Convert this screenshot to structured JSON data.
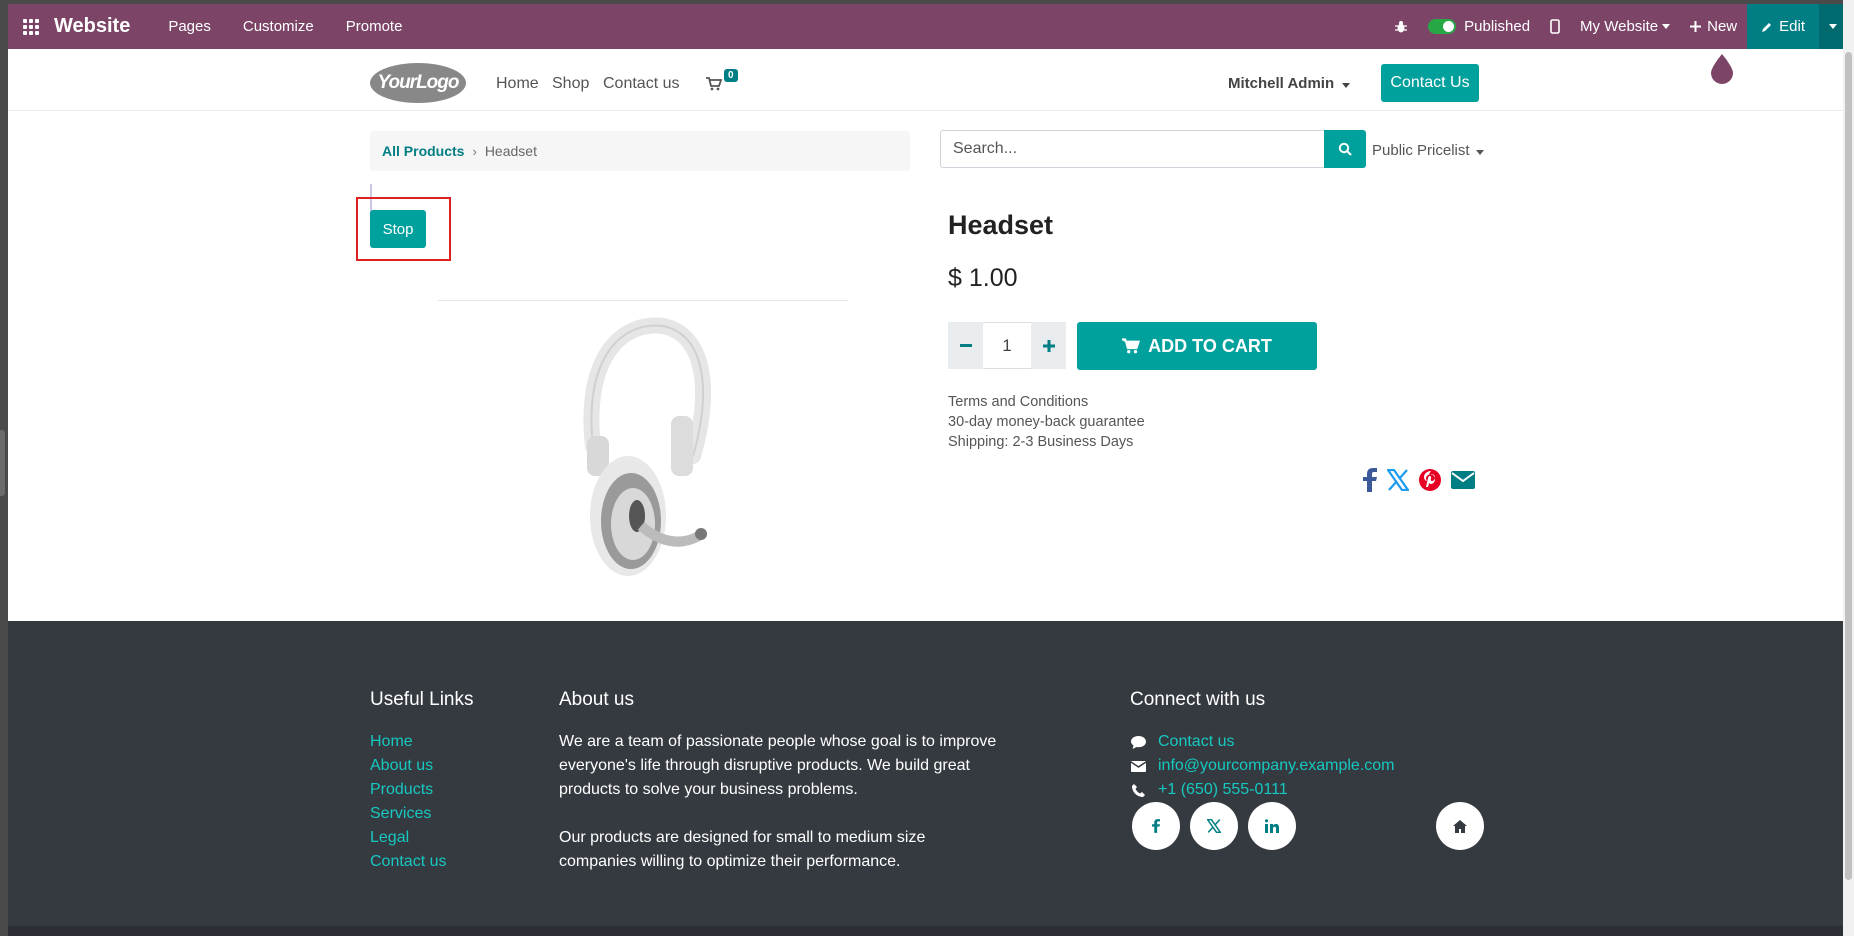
{
  "topbar": {
    "brand": "Website",
    "menu": [
      "Pages",
      "Customize",
      "Promote"
    ],
    "published_label": "Published",
    "website_label": "My Website",
    "new_label": "New",
    "edit_label": "Edit"
  },
  "header": {
    "logo_text": "YourLogo",
    "nav": [
      "Home",
      "Shop",
      "Contact us"
    ],
    "cart_count": "0",
    "user": "Mitchell Admin",
    "contact_button": "Contact Us"
  },
  "breadcrumb": {
    "parent": "All Products",
    "current": "Headset"
  },
  "search": {
    "placeholder": "Search..."
  },
  "pricelist": "Public Pricelist",
  "stop_button": "Stop",
  "product": {
    "name": "Headset",
    "price": "$ 1.00",
    "quantity": "1",
    "add_to_cart": "ADD TO CART",
    "terms": [
      "Terms and Conditions",
      "30-day money-back guarantee",
      "Shipping: 2-3 Business Days"
    ]
  },
  "footer": {
    "useful_links_title": "Useful Links",
    "useful_links": [
      "Home",
      "About us",
      "Products",
      "Services",
      "Legal",
      "Contact us"
    ],
    "about_title": "About us",
    "about_p1": "We are a team of passionate people whose goal is to improve everyone's life through disruptive products. We build great products to solve your business problems.",
    "about_p2": "Our products are designed for small to medium size companies willing to optimize their performance.",
    "connect_title": "Connect with us",
    "contact_link": "Contact us",
    "email": "info@yourcompany.example.com",
    "phone": "+1 (650) 555-0111"
  },
  "colors": {
    "admin_bar": "#7c4567",
    "primary": "#00a09d",
    "footer_bg": "#353a40",
    "footer_link": "#16c8c0"
  }
}
